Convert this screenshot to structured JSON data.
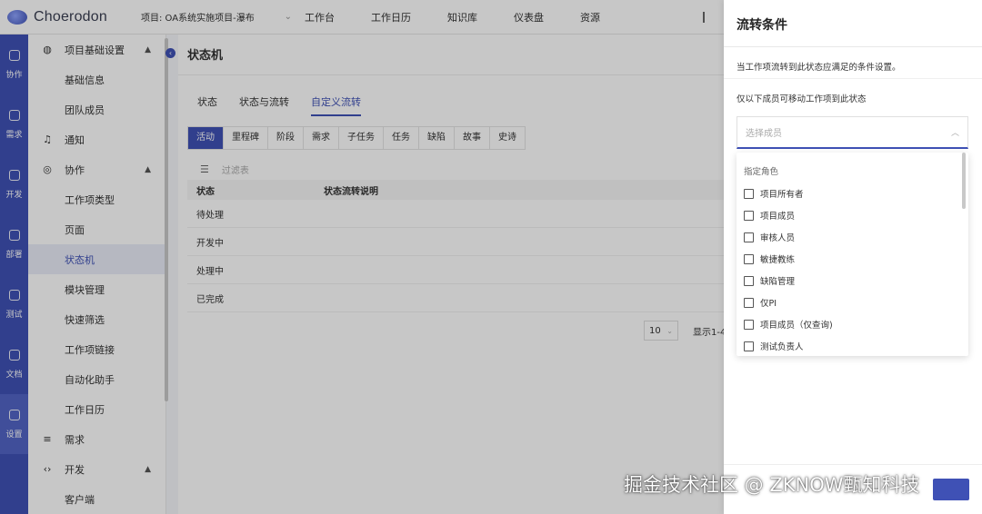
{
  "topbar": {
    "logo": "Choerodon",
    "project": "项目: OA系统实施项目-瀑布",
    "nav": [
      "工作台",
      "工作日历",
      "知识库",
      "仪表盘",
      "资源"
    ]
  },
  "rail": [
    {
      "label": "协作",
      "icon": "collab-icon"
    },
    {
      "label": "需求",
      "icon": "layers-icon"
    },
    {
      "label": "开发",
      "icon": "code-icon"
    },
    {
      "label": "部署",
      "icon": "deploy-icon"
    },
    {
      "label": "测试",
      "icon": "clipboard-icon"
    },
    {
      "label": "文档",
      "icon": "doc-icon"
    },
    {
      "label": "设置",
      "icon": "settings-icon"
    }
  ],
  "sidebar": {
    "group_settings": "项目基础设置",
    "settings_items": [
      "基础信息",
      "团队成员"
    ],
    "notify": "通知",
    "group_collab": "协作",
    "collab_items": [
      "工作项类型",
      "页面",
      "状态机",
      "模块管理",
      "快速筛选",
      "工作项链接",
      "自动化助手",
      "工作日历"
    ],
    "demand": "需求",
    "group_dev": "开发",
    "dev_items": [
      "客户端"
    ]
  },
  "main": {
    "title": "状态机",
    "tabs": [
      "状态",
      "状态与流转",
      "自定义流转"
    ],
    "type_tabs": [
      "活动",
      "里程碑",
      "阶段",
      "需求",
      "子任务",
      "任务",
      "缺陷",
      "故事",
      "史诗"
    ],
    "filter_placeholder": "过滤表",
    "table": {
      "headers": [
        "状态",
        "状态流转说明"
      ],
      "rows": [
        "待处理",
        "开发中",
        "处理中",
        "已完成"
      ]
    },
    "page_size": "10",
    "page_info": "显示1-4"
  },
  "drawer": {
    "title": "流转条件",
    "description": "当工作项流转到此状态应满足的条件设置。",
    "member_label": "仅以下成员可移动工作项到此状态",
    "member_placeholder": "选择成员",
    "dropdown_group": "指定角色",
    "roles": [
      "项目所有者",
      "项目成员",
      "审核人员",
      "敏捷教练",
      "缺陷管理",
      "仅PI",
      "项目成员（仅查询)",
      "测试负责人"
    ]
  },
  "watermark": "掘金技术社区 @ ZKNOW甄知科技",
  "colors": {
    "accent": "#3f51b5",
    "rail": "#3f51b5"
  }
}
